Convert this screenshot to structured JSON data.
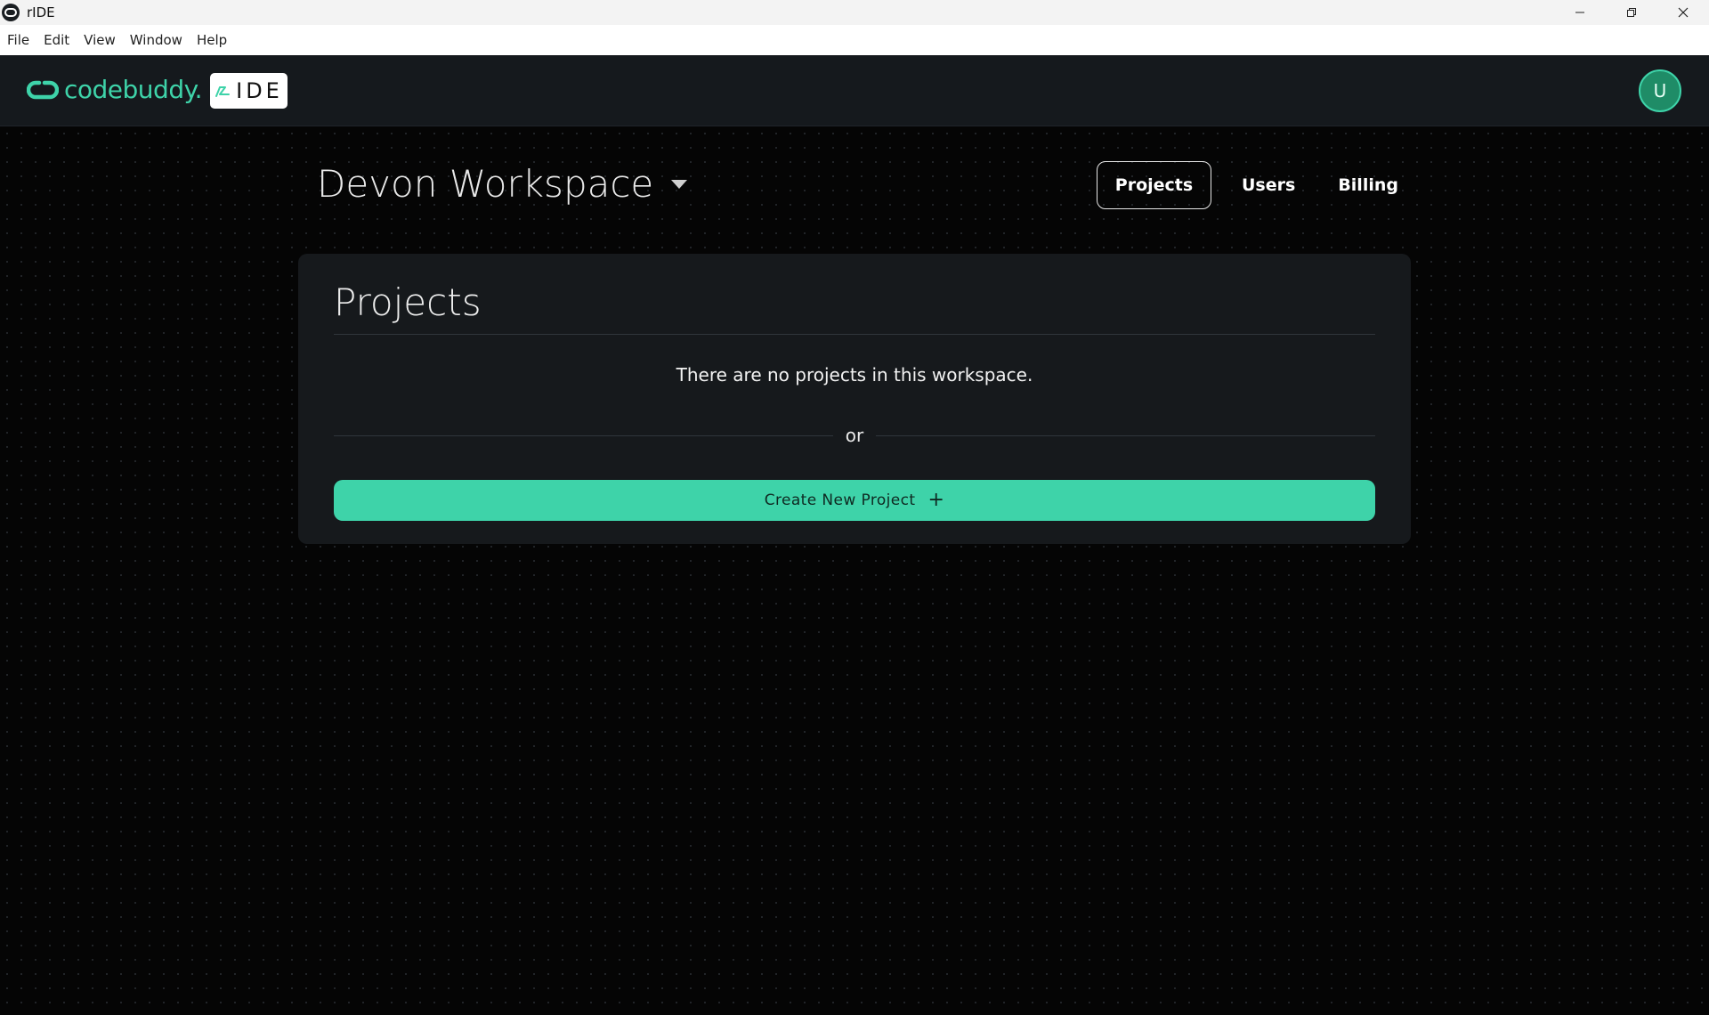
{
  "window": {
    "title": "rIDE",
    "controls": [
      "minimize-icon",
      "restore-icon",
      "close-icon"
    ]
  },
  "menubar": {
    "items": [
      "File",
      "Edit",
      "View",
      "Window",
      "Help"
    ]
  },
  "header": {
    "brand_text": "codebuddy.",
    "badge_text": "IDE",
    "avatar_initial": "U",
    "accent_color": "#3ed3a9"
  },
  "workspace": {
    "name": "Devon Workspace"
  },
  "nav": {
    "tabs": [
      {
        "label": "Projects",
        "active": true
      },
      {
        "label": "Users",
        "active": false
      },
      {
        "label": "Billing",
        "active": false
      }
    ]
  },
  "projects_card": {
    "title": "Projects",
    "empty_message": "There are no projects in this workspace.",
    "separator_text": "or",
    "create_button_label": "Create New Project",
    "create_button_icon": "plus-icon"
  }
}
